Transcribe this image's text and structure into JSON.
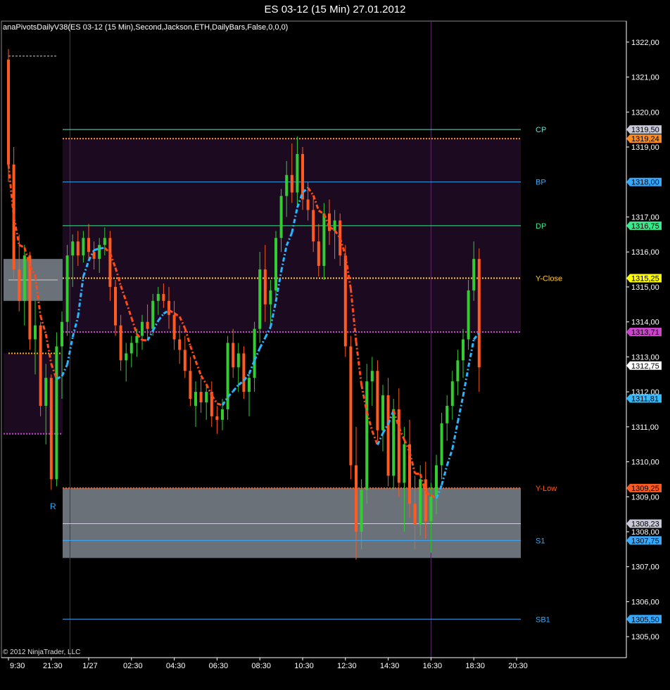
{
  "window_title": "ES 03-12 (15 Min)  27.01.2012",
  "indicator_label": "anaPivotsDailyV38(ES 03-12 (15 Min),Second,Jackson,ETH,DailyBars,False,0,0,0)",
  "copyright": "© 2012 NinjaTrader, LLC",
  "colors": {
    "background": "#000000",
    "up_candle": "#33cc33",
    "down_candle": "#ff5a1f",
    "ma_up": "#2ab6ff",
    "ma_down": "#ff4a1a",
    "zone_fill": "#1a0a1f",
    "sr_box": "#7d858d",
    "axis": "#ffffff"
  },
  "chart_data": {
    "type": "candlestick",
    "title": "ES 03-12 (15 Min)  27.01.2012",
    "ylim": [
      1304.4,
      1322.6
    ],
    "y_ticks": [
      "1305,00",
      "1306,00",
      "1307,00",
      "1308,00",
      "1309,00",
      "1310,00",
      "1311,00",
      "1312,00",
      "1313,00",
      "1314,00",
      "1315,00",
      "1316,00",
      "1317,00",
      "1318,00",
      "1319,00",
      "1320,00",
      "1321,00",
      "1322,00"
    ],
    "y_tick_values": [
      1305,
      1306,
      1307,
      1308,
      1309,
      1310,
      1311,
      1312,
      1313,
      1314,
      1315,
      1316,
      1317,
      1318,
      1319,
      1320,
      1321,
      1322
    ],
    "x_tick_labels": [
      "9:30",
      "21:30",
      "1/27",
      "02:30",
      "04:30",
      "06:30",
      "08:30",
      "10:30",
      "12:30",
      "14:30",
      "16:30",
      "18:30",
      "20:30"
    ],
    "x_tick_bars": [
      0,
      8,
      15,
      23,
      31,
      39,
      47,
      55,
      63,
      71,
      79,
      87,
      95
    ],
    "session_separators": [
      11.5,
      79
    ],
    "pivot_levels": [
      {
        "label": "CP",
        "value": 1319.5,
        "color": "#66ddcc",
        "style": "solid",
        "badge": "1319,50",
        "badge_color": "#c8c8d8"
      },
      {
        "label": "",
        "value": 1319.24,
        "color": "#ff8a1f",
        "style": "dotted",
        "badge": "1319,24",
        "badge_color": "#ff8a1f"
      },
      {
        "label": "BP",
        "value": 1318.0,
        "color": "#33aaff",
        "style": "solid",
        "badge": "1318,00",
        "badge_color": "#33aaff"
      },
      {
        "label": "DP",
        "value": 1316.75,
        "color": "#33ee88",
        "style": "solid",
        "badge": "1316,75",
        "badge_color": "#33ee88"
      },
      {
        "label": "Y-Close",
        "value": 1315.25,
        "color": "#ffcc33",
        "style": "dotted",
        "badge": "1315,25",
        "badge_color": "#ffff00"
      },
      {
        "label": "",
        "value": 1313.71,
        "color": "#cc44cc",
        "style": "dotted",
        "badge": "1313,71",
        "badge_color": "#cc44cc"
      },
      {
        "label": "",
        "value": 1312.75,
        "color": "#ffffff",
        "style": "none",
        "badge": "1312,75",
        "badge_color": "#ffffff"
      },
      {
        "label": "",
        "value": 1311.81,
        "color": "#33bbff",
        "style": "none",
        "badge": "1311,81",
        "badge_color": "#33bbff"
      },
      {
        "label": "Y-Low",
        "value": 1309.25,
        "color": "#ff5a1f",
        "style": "dotted",
        "badge": "1309,25",
        "badge_color": "#ff5a1f"
      },
      {
        "label": "",
        "value": 1308.23,
        "color": "#ccccdd",
        "style": "solid",
        "badge": "1308,23",
        "badge_color": "#c8c8d8"
      },
      {
        "label": "S1",
        "value": 1307.75,
        "color": "#33aaff",
        "style": "solid",
        "badge": "1307,75",
        "badge_color": "#33aaff"
      },
      {
        "label": "SB1",
        "value": 1305.5,
        "color": "#33aaff",
        "style": "solid",
        "badge": "1305,50",
        "badge_color": "#33aaff"
      }
    ],
    "zones": [
      {
        "from": 1313.71,
        "to": 1319.24,
        "color": "#1c0a20"
      },
      {
        "from": 1307.25,
        "to": 1309.25,
        "color": "#7d858d"
      }
    ],
    "prev_zones": [
      {
        "from": 1310.8,
        "to": 1313.1,
        "color": "#1c0a20"
      },
      {
        "from": 1314.6,
        "to": 1315.8,
        "color": "#7d858d"
      }
    ],
    "prev_marker": "R",
    "candles": [
      [
        1321.5,
        1321.8,
        1318.0,
        1318.5
      ],
      [
        1318.5,
        1319.0,
        1315.2,
        1315.5
      ],
      [
        1315.5,
        1316.5,
        1314.3,
        1314.6
      ],
      [
        1314.6,
        1316.2,
        1313.9,
        1315.9
      ],
      [
        1315.9,
        1316.0,
        1313.2,
        1313.5
      ],
      [
        1313.5,
        1314.6,
        1312.5,
        1313.9
      ],
      [
        1313.9,
        1314.0,
        1311.3,
        1311.6
      ],
      [
        1311.6,
        1312.8,
        1310.5,
        1312.4
      ],
      [
        1312.4,
        1312.5,
        1309.2,
        1309.5
      ],
      [
        1309.5,
        1313.7,
        1309.3,
        1313.3
      ],
      [
        1313.3,
        1314.3,
        1311.8,
        1314.0
      ],
      [
        1314.0,
        1316.2,
        1313.6,
        1315.9
      ],
      [
        1315.9,
        1316.5,
        1315.0,
        1316.3
      ],
      [
        1316.3,
        1316.6,
        1315.6,
        1315.9
      ],
      [
        1315.9,
        1316.6,
        1315.7,
        1316.4
      ],
      [
        1316.4,
        1316.8,
        1315.8,
        1316.0
      ],
      [
        1316.0,
        1316.3,
        1315.5,
        1315.8
      ],
      [
        1315.8,
        1316.4,
        1315.4,
        1316.2
      ],
      [
        1316.2,
        1316.7,
        1315.9,
        1316.4
      ],
      [
        1316.4,
        1316.6,
        1314.6,
        1315.0
      ],
      [
        1315.0,
        1315.2,
        1313.6,
        1313.9
      ],
      [
        1313.9,
        1314.2,
        1312.6,
        1312.9
      ],
      [
        1312.9,
        1313.4,
        1312.3,
        1313.1
      ],
      [
        1313.1,
        1313.6,
        1312.7,
        1313.4
      ],
      [
        1313.4,
        1313.8,
        1313.0,
        1313.6
      ],
      [
        1313.6,
        1314.2,
        1313.2,
        1314.0
      ],
      [
        1314.0,
        1314.5,
        1313.5,
        1313.8
      ],
      [
        1313.8,
        1314.8,
        1313.6,
        1314.6
      ],
      [
        1314.6,
        1315.0,
        1314.2,
        1314.8
      ],
      [
        1314.8,
        1315.1,
        1314.4,
        1314.6
      ],
      [
        1314.6,
        1315.0,
        1313.8,
        1314.2
      ],
      [
        1314.2,
        1314.6,
        1313.2,
        1313.5
      ],
      [
        1313.5,
        1313.9,
        1312.8,
        1313.2
      ],
      [
        1313.2,
        1313.6,
        1312.4,
        1312.6
      ],
      [
        1312.6,
        1313.0,
        1311.6,
        1311.8
      ],
      [
        1311.6,
        1312.3,
        1311.0,
        1312.0
      ],
      [
        1312.0,
        1312.4,
        1311.4,
        1311.7
      ],
      [
        1311.7,
        1312.2,
        1311.2,
        1312.0
      ],
      [
        1312.0,
        1312.3,
        1311.0,
        1311.3
      ],
      [
        1311.3,
        1311.6,
        1310.8,
        1311.2
      ],
      [
        1311.2,
        1311.8,
        1310.9,
        1311.5
      ],
      [
        1311.5,
        1313.6,
        1311.2,
        1313.4
      ],
      [
        1313.4,
        1313.8,
        1312.4,
        1312.7
      ],
      [
        1312.7,
        1313.4,
        1312.0,
        1313.1
      ],
      [
        1313.1,
        1313.3,
        1311.8,
        1312.0
      ],
      [
        1312.0,
        1312.6,
        1311.3,
        1312.4
      ],
      [
        1312.4,
        1314.0,
        1312.0,
        1313.8
      ],
      [
        1313.8,
        1316.0,
        1313.4,
        1315.5
      ],
      [
        1315.5,
        1316.2,
        1314.0,
        1314.5
      ],
      [
        1314.5,
        1315.2,
        1313.8,
        1314.9
      ],
      [
        1314.9,
        1316.6,
        1314.6,
        1316.4
      ],
      [
        1316.4,
        1317.8,
        1316.0,
        1317.6
      ],
      [
        1317.6,
        1318.6,
        1317.0,
        1318.2
      ],
      [
        1318.2,
        1319.1,
        1317.4,
        1317.7
      ],
      [
        1317.7,
        1319.3,
        1317.3,
        1318.8
      ],
      [
        1318.8,
        1319.0,
        1317.2,
        1317.5
      ],
      [
        1317.5,
        1318.0,
        1316.9,
        1317.2
      ],
      [
        1317.2,
        1317.6,
        1316.0,
        1316.3
      ],
      [
        1316.3,
        1316.8,
        1315.3,
        1315.6
      ],
      [
        1315.6,
        1317.4,
        1315.2,
        1317.1
      ],
      [
        1317.1,
        1317.5,
        1316.2,
        1316.6
      ],
      [
        1316.6,
        1317.2,
        1315.8,
        1316.9
      ],
      [
        1316.9,
        1317.1,
        1315.6,
        1315.9
      ],
      [
        1315.9,
        1316.2,
        1313.0,
        1313.3
      ],
      [
        1313.3,
        1313.6,
        1309.5,
        1309.9
      ],
      [
        1309.9,
        1311.0,
        1307.2,
        1308.0
      ],
      [
        1308.0,
        1309.5,
        1307.5,
        1309.2
      ],
      [
        1309.2,
        1312.8,
        1308.8,
        1312.3
      ],
      [
        1312.3,
        1313.0,
        1311.6,
        1312.6
      ],
      [
        1312.6,
        1312.9,
        1310.6,
        1310.9
      ],
      [
        1310.9,
        1312.2,
        1310.3,
        1311.9
      ],
      [
        1311.9,
        1312.4,
        1309.3,
        1309.6
      ],
      [
        1309.6,
        1311.8,
        1309.2,
        1311.5
      ],
      [
        1311.5,
        1312.1,
        1309.0,
        1309.4
      ],
      [
        1309.4,
        1311.0,
        1308.0,
        1310.5
      ],
      [
        1310.5,
        1311.2,
        1308.4,
        1308.8
      ],
      [
        1308.8,
        1309.6,
        1307.5,
        1308.2
      ],
      [
        1308.2,
        1309.9,
        1307.9,
        1309.5
      ],
      [
        1309.5,
        1310.0,
        1307.8,
        1308.3
      ],
      [
        1308.3,
        1309.4,
        1307.4,
        1309.0
      ],
      [
        1309.0,
        1310.2,
        1308.5,
        1309.9
      ],
      [
        1309.9,
        1311.4,
        1309.5,
        1311.1
      ],
      [
        1311.1,
        1311.9,
        1310.6,
        1311.6
      ],
      [
        1311.6,
        1312.6,
        1311.2,
        1312.3
      ],
      [
        1312.3,
        1313.2,
        1311.9,
        1312.9
      ],
      [
        1312.9,
        1313.8,
        1312.4,
        1313.5
      ],
      [
        1313.5,
        1315.2,
        1313.2,
        1314.9
      ],
      [
        1314.9,
        1316.3,
        1314.6,
        1315.8
      ],
      [
        1315.8,
        1316.1,
        1312.0,
        1312.7
      ]
    ]
  }
}
